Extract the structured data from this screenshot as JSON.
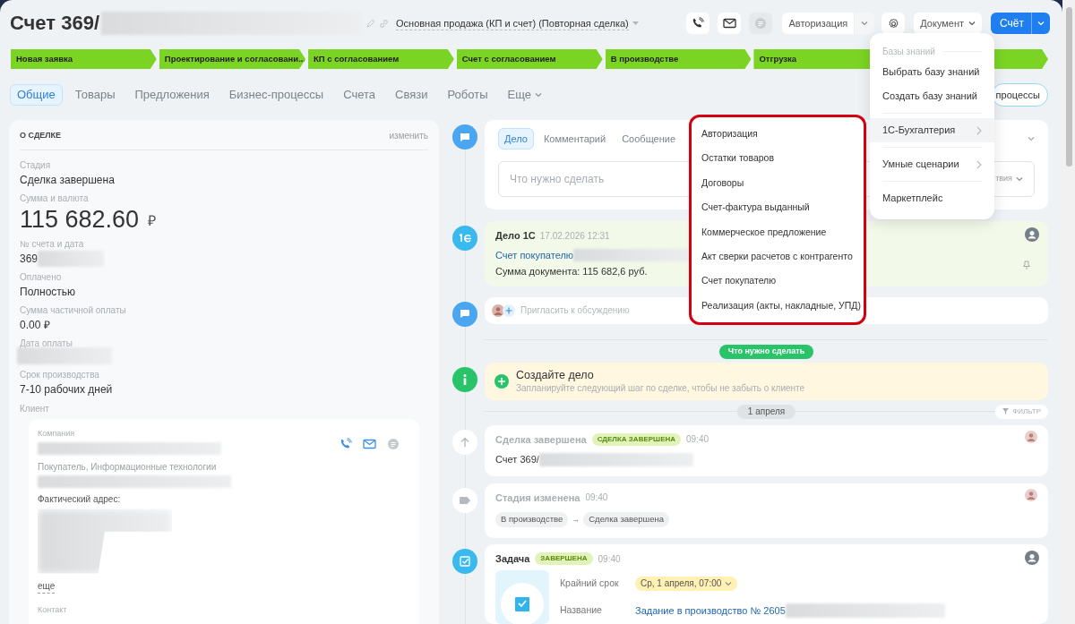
{
  "header": {
    "title": "Счет 369/",
    "pipeline": "Основная продажа (КП и счет) (Повторная сделка)",
    "icon_buttons": [
      {
        "kind": "phone",
        "disabled": false
      },
      {
        "kind": "mail",
        "disabled": false
      },
      {
        "kind": "chat",
        "disabled": true
      }
    ],
    "auth_button": "Авторизация",
    "document_button": "Документ",
    "primary_button": "Счёт"
  },
  "stages": [
    {
      "kind": "stage",
      "label": "Новая заявка"
    },
    {
      "kind": "stage",
      "label": "Проектирование и согласовани..."
    },
    {
      "kind": "stage",
      "label": "КП с согласованием"
    },
    {
      "kind": "stage",
      "label": "Счет с согласованием"
    },
    {
      "kind": "stage",
      "label": "В производстве"
    },
    {
      "kind": "stage",
      "label": "Отгрузка"
    },
    {
      "kind": "stage"
    }
  ],
  "tabs": [
    {
      "label": "Общие",
      "selected": true
    },
    {
      "label": "Товары",
      "selected": false
    },
    {
      "label": "Предложения",
      "selected": false
    },
    {
      "label": "Бизнес-процессы",
      "selected": false
    },
    {
      "label": "Счета",
      "selected": false
    },
    {
      "label": "Связи",
      "selected": false
    },
    {
      "label": "Роботы",
      "selected": false
    },
    {
      "label": "Еще",
      "selected": false,
      "dropdown": true
    }
  ],
  "processes_button": "процессы",
  "deal_panel": {
    "title": "О СДЕЛКЕ",
    "edit_link": "изменить",
    "fields": [
      {
        "label": "Стадия",
        "kind": "text",
        "value": "Сделка завершена"
      },
      {
        "label": "Сумма и валюта",
        "kind": "amount",
        "value": "115 682.60",
        "currency": "₽"
      },
      {
        "label": "№ счета и дата",
        "kind": "text",
        "value": "369",
        "redacted": true
      },
      {
        "label": "Оплачено",
        "kind": "text",
        "value": "Полностью"
      },
      {
        "label": "Сумма частичной оплаты",
        "kind": "text",
        "value": "0.00 ₽"
      },
      {
        "label": "Дата оплаты",
        "kind": "redacted"
      },
      {
        "label": "Срок производства",
        "kind": "text",
        "value": "7-10 рабочих дней"
      }
    ],
    "client": {
      "label": "Клиент",
      "company_label": "Компания",
      "category": "Покупатель, Информационные технологии",
      "address_label": "Фактический адрес:",
      "more_link": "еще",
      "contact_label": "Контакт"
    }
  },
  "timeline": {
    "editor": {
      "tabs": [
        {
          "label": "Дело",
          "selected": true
        },
        {
          "label": "Комментарий",
          "selected": false
        },
        {
          "label": "Сообщение",
          "selected": false
        }
      ],
      "placeholder": "Что нужно сделать",
      "tail_label": "твия"
    },
    "onec_item": {
      "title": "Дело 1С",
      "date": "17.02.2026 12:31",
      "link": "Счет покупателю",
      "sum": "Сумма документа: 115 682,6 руб."
    },
    "invite": {
      "placeholder": "Пригласить к обсуждению"
    },
    "todo_pill": "Что нужно сделать",
    "create_card": {
      "title": "Создайте дело",
      "subtitle": "Запланируйте следующий шаг по сделке, чтобы не забыть о клиенте"
    },
    "date_pill": "1 апреля",
    "filter_button": "ФИЛЬТР",
    "events": [
      {
        "kind": "deal_closed",
        "title": "Сделка завершена",
        "badge": "СДЕЛКА ЗАВЕРШЕНА",
        "time": "09:40",
        "text": "Счет 369/"
      },
      {
        "kind": "stage_changed",
        "title": "Стадия изменена",
        "time": "09:40",
        "from": "В производстве",
        "arrow": "→",
        "to": "Сделка завершена"
      },
      {
        "kind": "task",
        "title": "Задача",
        "badge": "ЗАВЕРШЕНА",
        "time": "09:40",
        "deadline_label": "Крайний срок",
        "deadline": "Ср, 1 апреля, 07:00",
        "name_label": "Название",
        "name": "Задание в производство № 2605"
      }
    ]
  },
  "document_menu": {
    "section": "Базы знаний",
    "items": [
      {
        "label": "Выбрать базу знаний",
        "submenu": false,
        "selected": false
      },
      {
        "label": "Создать базу знаний",
        "submenu": false,
        "selected": false,
        "divider_after": true
      },
      {
        "label": "1С-Бухгалтерия",
        "submenu": true,
        "selected": true,
        "divider_after": true
      },
      {
        "label": "Умные сценарии",
        "submenu": true,
        "selected": false,
        "divider_after": true
      },
      {
        "label": "Маркетплейс",
        "submenu": false,
        "selected": false
      }
    ]
  },
  "onec_menu": {
    "items": [
      "Авторизация",
      "Остатки товаров",
      "Договоры",
      "Счет-фактура выданный",
      "Коммерческое предложение",
      "Акт сверки расчетов с контрагенто",
      "Счет покупателю",
      "Реализация (акты, накладные, УПД)"
    ]
  }
}
